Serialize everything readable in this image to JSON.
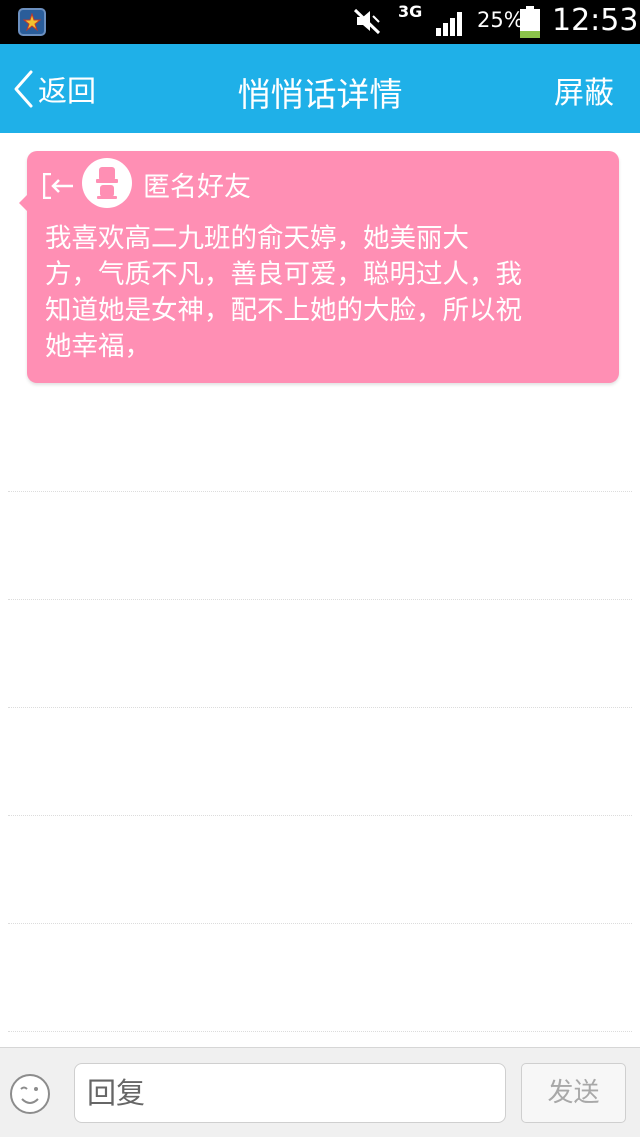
{
  "status_bar": {
    "network": "3G",
    "battery_percent": "25%",
    "battery_level": 0.25,
    "time": "12:53",
    "icons": [
      "app-icon",
      "mute-icon",
      "signal-icon",
      "battery-icon"
    ]
  },
  "nav": {
    "back_label": "返回",
    "title": "悄悄话详情",
    "block_label": "屏蔽"
  },
  "message": {
    "sender": "匿名好友",
    "text": "我喜欢高二九班的俞天婷，她美丽大方，气质不凡，善良可爱，聪明过人，我知道她是女神，配不上她的大脸，所以祝她幸福，",
    "lines": [
      "我喜欢高二九班的俞天婷，她美丽大",
      "方，气质不凡，善良可爱，聪明过人，我",
      "知道她是女神，配不上她的大脸，所以祝",
      "她幸福，"
    ],
    "card_color": "#ff8fb4"
  },
  "input_bar": {
    "reply_placeholder": "回复",
    "send_label": "发送"
  },
  "colors": {
    "accent": "#1fb0e8",
    "status_bar": "#000000",
    "battery_fill": "#8bc34a"
  }
}
